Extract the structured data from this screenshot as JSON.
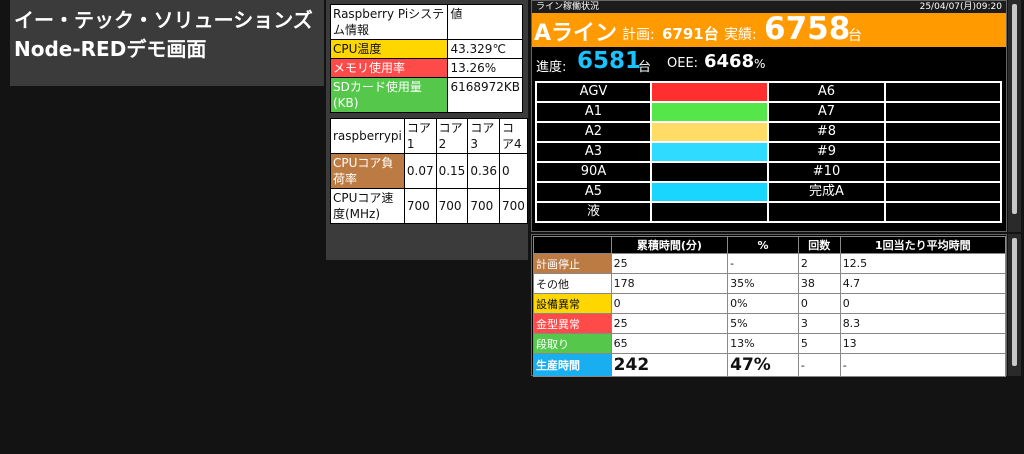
{
  "title": {
    "line1": "イー・テック・ソリューションズ",
    "line2": "Node-REDデモ画面"
  },
  "system": {
    "header": [
      "Raspberry Piシステム情報",
      "値"
    ],
    "rows": [
      {
        "label": "CPU温度",
        "value": "43.329℃"
      },
      {
        "label": "メモリ使用率",
        "value": "13.26%"
      },
      {
        "label": "SDカード使用量(KB)",
        "value": "6168972KB"
      }
    ],
    "colors": {
      "cpu": "#ffd700",
      "memory": "#ff4a4a",
      "sd": "#55c84c"
    }
  },
  "cores": {
    "header": [
      "raspberrypi",
      "コア1",
      "コア2",
      "コア3",
      "コア4"
    ],
    "load": {
      "label": "CPUコア負荷率",
      "values": [
        "0.07",
        "0.15",
        "0.36",
        "0"
      ]
    },
    "speed": {
      "label": "CPUコア速度(MHz)",
      "values": [
        "700",
        "700",
        "700",
        "700"
      ]
    }
  },
  "line": {
    "header_title": "ライン稼働状況",
    "datetime": "25/04/07(月)09:20",
    "name": "Aライン",
    "plan_label": "計画:",
    "plan_value": "6791台",
    "actual_label": "実績:",
    "actual_value": "6758",
    "actual_unit": "台",
    "progress_label": "進度:",
    "progress_value": "6581",
    "progress_unit": "台",
    "oee_label": "OEE:",
    "oee_value": "6468",
    "oee_unit": "%",
    "stations": [
      {
        "left": "AGV",
        "left_color": "#ff2f2f",
        "right": "A6"
      },
      {
        "left": "A1",
        "left_color": "#55e64a",
        "right": "A7"
      },
      {
        "left": "A2",
        "left_color": "#ffdc66",
        "right": "#8"
      },
      {
        "left": "A3",
        "left_color": "#2fdcff",
        "right": "#9"
      },
      {
        "left": "90A",
        "left_color": "#000000",
        "right": "#10"
      },
      {
        "left": "A5",
        "left_color": "#18d6ff",
        "right": "完成A"
      },
      {
        "left": "液",
        "left_color": "#000000",
        "right": ""
      }
    ]
  },
  "stats": {
    "headers": [
      "",
      "累積時間(分)",
      "%",
      "回数",
      "1回当たり平均時間"
    ],
    "rows": [
      {
        "label": "計画停止",
        "cls": "c-brown",
        "time": "25",
        "pct": "-",
        "count": "2",
        "avg": "12.5"
      },
      {
        "label": "その他",
        "cls": "c-white",
        "time": "178",
        "pct": "35%",
        "count": "38",
        "avg": "4.7"
      },
      {
        "label": "設備異常",
        "cls": "c-yellow",
        "time": "0",
        "pct": "0%",
        "count": "0",
        "avg": "0"
      },
      {
        "label": "金型異常",
        "cls": "c-red",
        "time": "25",
        "pct": "5%",
        "count": "3",
        "avg": "8.3"
      },
      {
        "label": "段取り",
        "cls": "c-green",
        "time": "65",
        "pct": "13%",
        "count": "5",
        "avg": "13"
      }
    ],
    "production": {
      "label": "生産時間",
      "time": "242",
      "pct": "47%",
      "count": "-",
      "avg": "-"
    }
  }
}
